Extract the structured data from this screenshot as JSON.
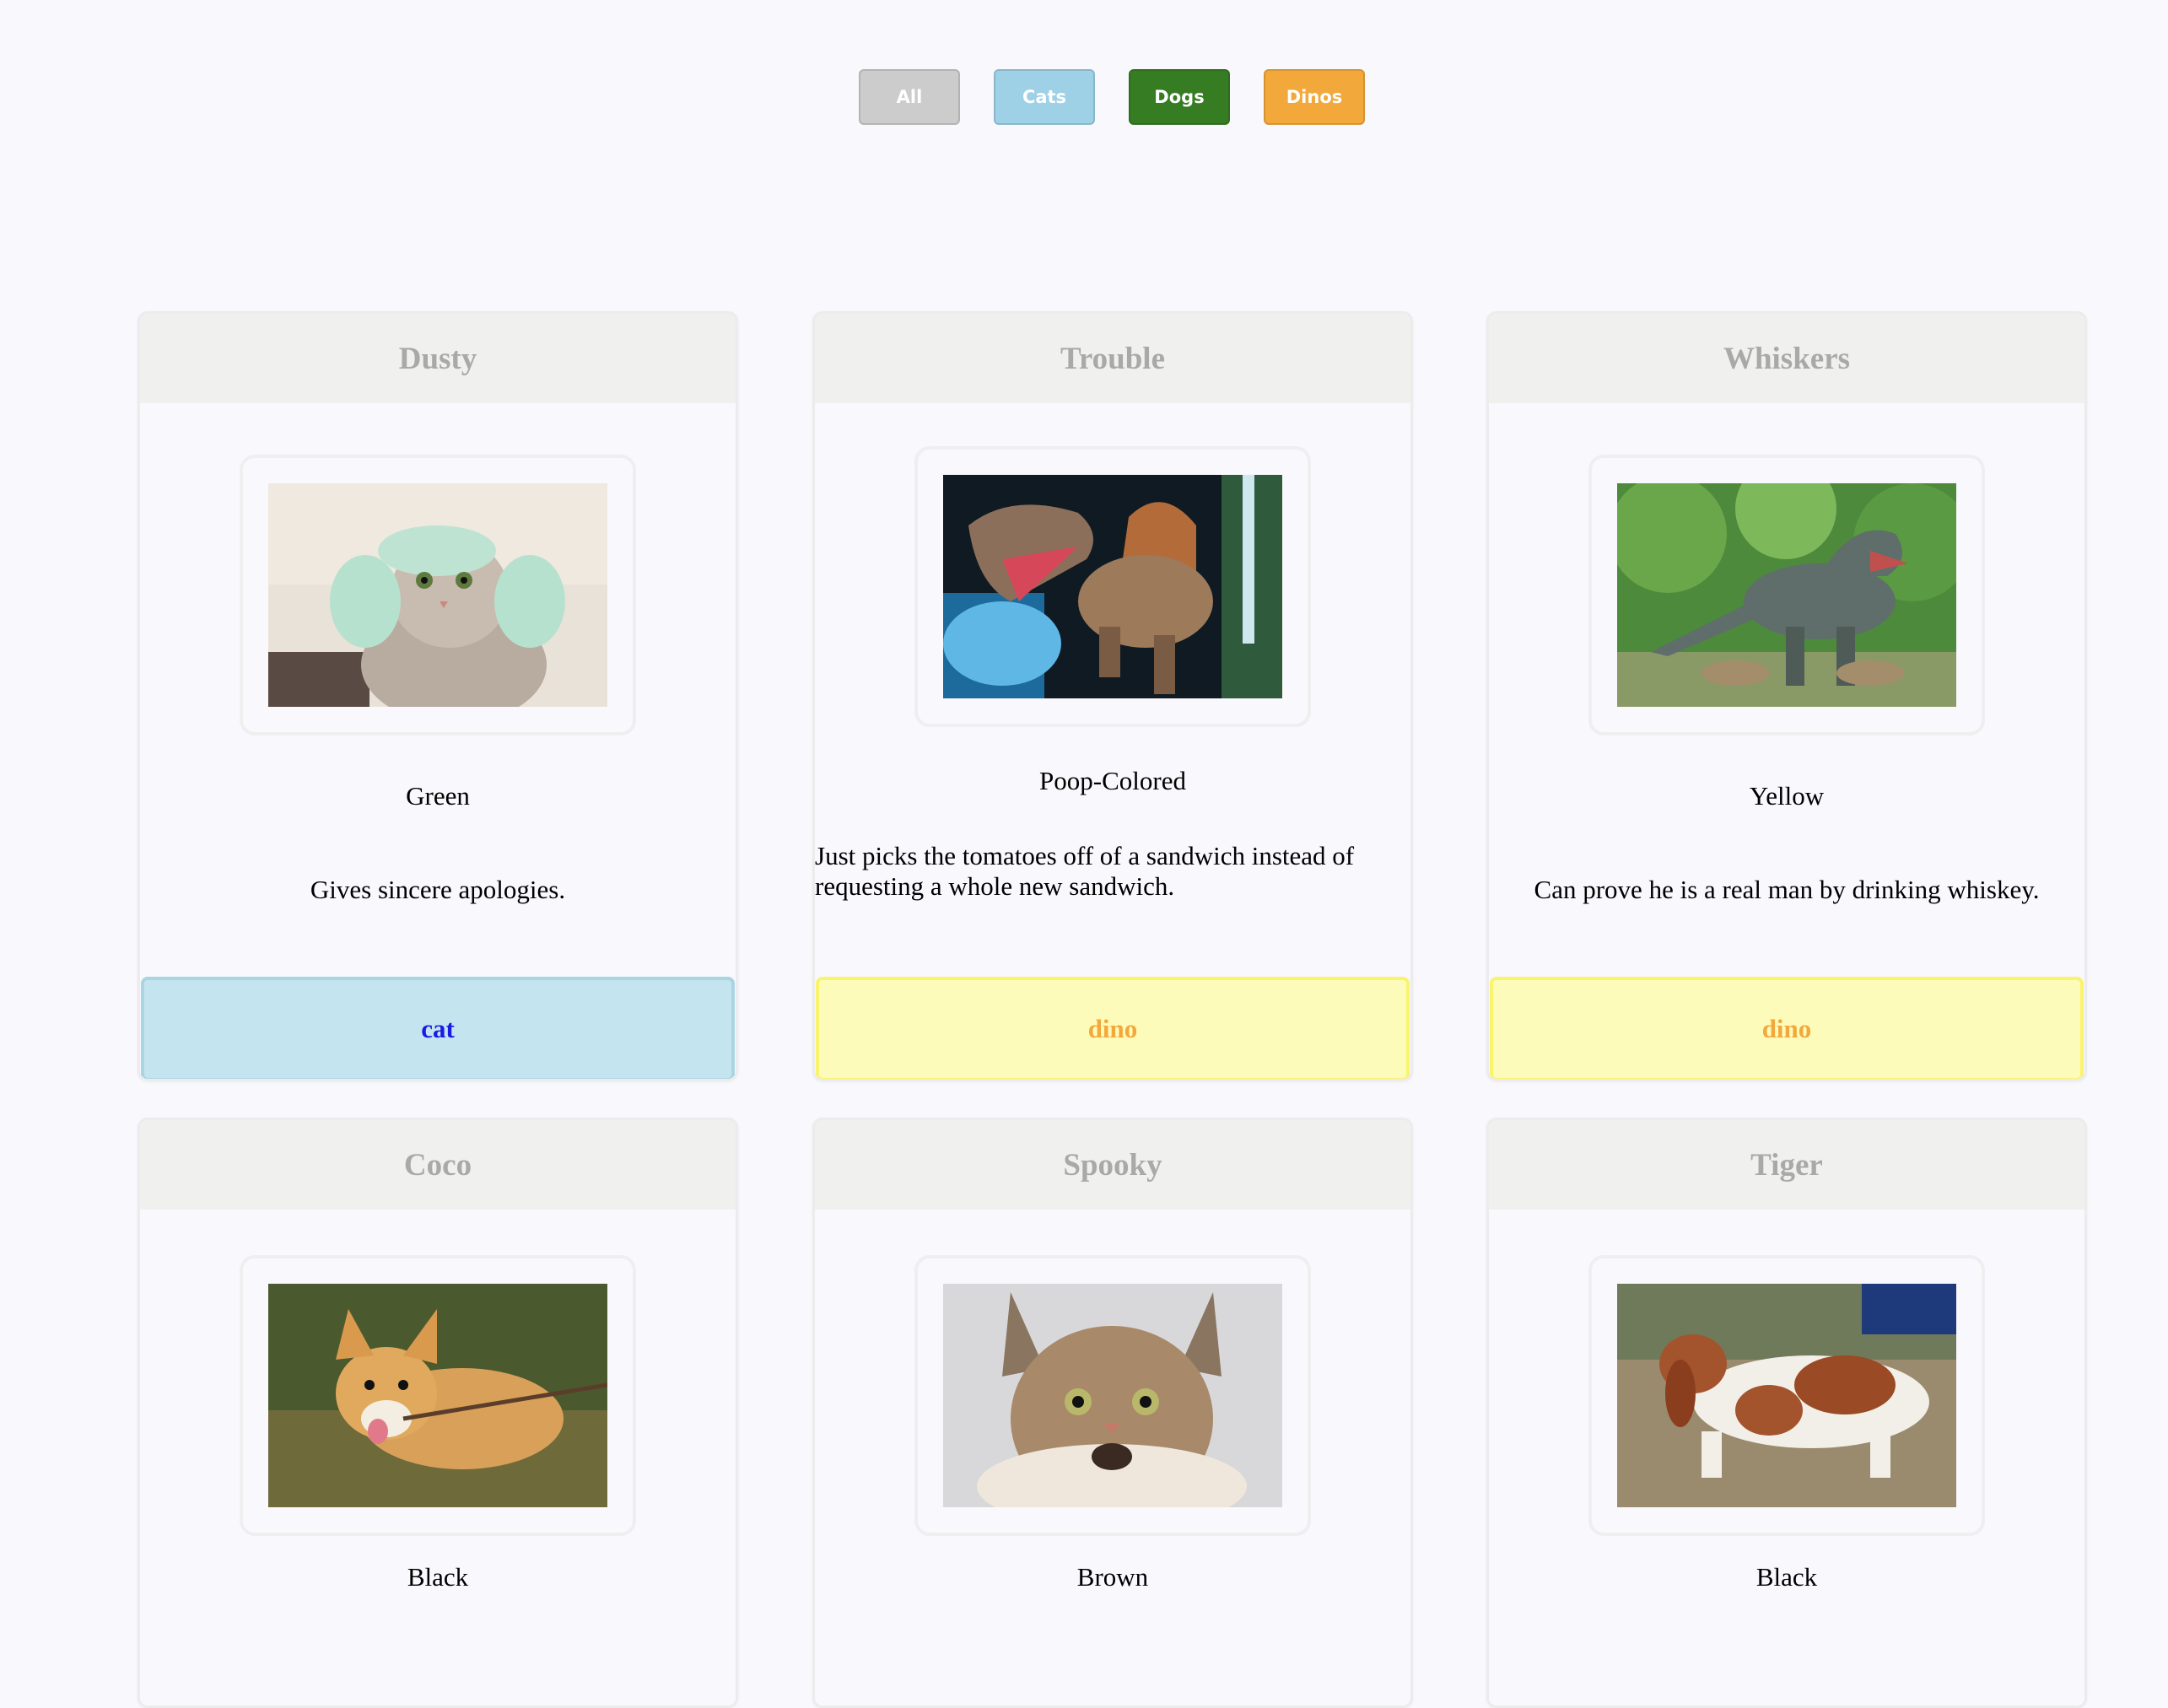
{
  "filters": [
    {
      "label": "All",
      "color": "#cccccc"
    },
    {
      "label": "Cats",
      "color": "#9ed0e6"
    },
    {
      "label": "Dogs",
      "color": "#367c23"
    },
    {
      "label": "Dinos",
      "color": "#f2a83a"
    }
  ],
  "cards": [
    {
      "name": "Dusty",
      "color": "Green",
      "description": "Gives sincere apologies.",
      "type": "cat",
      "photo": "cat-with-towel-hat-photo"
    },
    {
      "name": "Trouble",
      "color": "Poop-Colored",
      "description": "Just picks the tomatoes off of a sandwich instead of requesting a whole new sandwich.",
      "type": "dino",
      "photo": "spinosaurus-photo"
    },
    {
      "name": "Whiskers",
      "color": "Yellow",
      "description": "Can prove he is a real man by drinking whiskey.",
      "type": "dino",
      "photo": "t-rex-statue-photo"
    },
    {
      "name": "Coco",
      "color": "Black",
      "description": "",
      "type": "",
      "photo": "corgi-with-stick-photo"
    },
    {
      "name": "Spooky",
      "color": "Brown",
      "description": "",
      "type": "",
      "photo": "maine-coon-cat-photo"
    },
    {
      "name": "Tiger",
      "color": "Black",
      "description": "",
      "type": "",
      "photo": "basset-hound-photo"
    }
  ]
}
